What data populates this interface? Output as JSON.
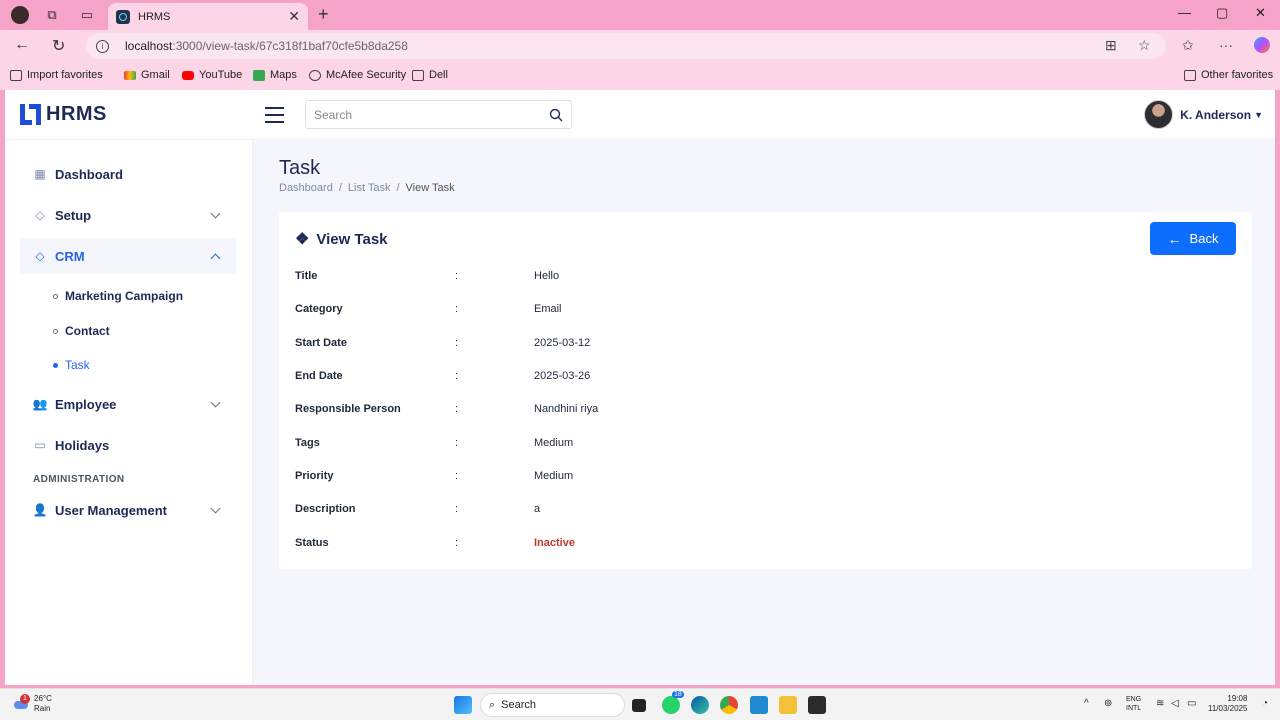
{
  "browser": {
    "tab_title": "HRMS",
    "url_host": "localhost",
    "url_path": ":3000/view-task/67c318f1baf70cfe5b8da258",
    "bookmarks": [
      "Import favorites",
      "Gmail",
      "YouTube",
      "Maps",
      "McAfee Security",
      "Dell"
    ],
    "other_favorites": "Other favorites"
  },
  "app": {
    "logo": "HRMS",
    "search_placeholder": "Search",
    "user_name": "K. Anderson"
  },
  "sidebar": {
    "dashboard": "Dashboard",
    "setup": "Setup",
    "crm": "CRM",
    "crm_items": [
      "Marketing Campaign",
      "Contact",
      "Task"
    ],
    "employee": "Employee",
    "holidays": "Holidays",
    "section": "ADMINISTRATION",
    "user_management": "User Management"
  },
  "page": {
    "title": "Task",
    "breadcrumb": [
      "Dashboard",
      "List Task",
      "View Task"
    ],
    "card_title": "View Task",
    "back_label": "Back",
    "fields": [
      {
        "label": "Title",
        "value": "Hello"
      },
      {
        "label": "Category",
        "value": "Email"
      },
      {
        "label": "Start Date",
        "value": "2025-03-12"
      },
      {
        "label": "End Date",
        "value": "2025-03-26"
      },
      {
        "label": "Responsible Person",
        "value": "Nandhini riya"
      },
      {
        "label": "Tags",
        "value": "Medium"
      },
      {
        "label": "Priority",
        "value": "Medium"
      },
      {
        "label": "Description",
        "value": "a"
      },
      {
        "label": "Status",
        "value": "Inactive"
      }
    ]
  },
  "taskbar": {
    "weather_temp": "26°C",
    "weather_desc": "Rain",
    "weather_badge": "1",
    "search": "Search",
    "whatsapp_badge": "18",
    "lang": "ENG",
    "lang2": "INTL",
    "time": "19:08",
    "date": "11/03/2025"
  },
  "colors": {
    "accent": "#0d6efd",
    "status_inactive": "#c0392b",
    "chrome": "#f5a3c7"
  }
}
